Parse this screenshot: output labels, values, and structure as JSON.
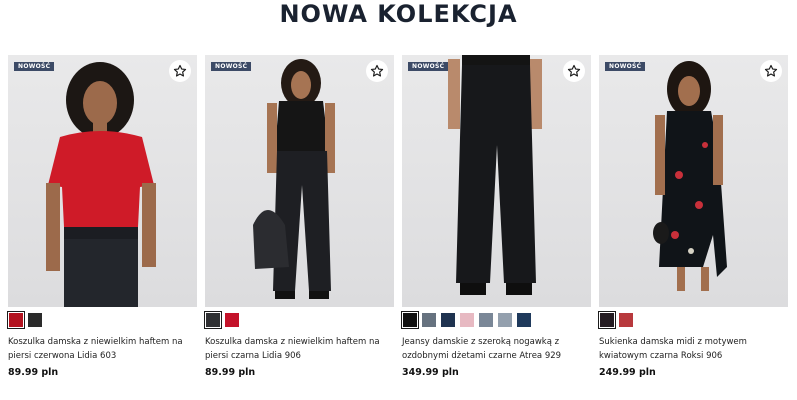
{
  "section": {
    "title": "NOWA KOLEKCJA"
  },
  "products": [
    {
      "badge": "NOWOŚĆ",
      "name": "Koszulka damska z niewielkim haftem na piersi czerwona Lidia 603",
      "price": "89.99 pln",
      "swatches": [
        "#b3121f",
        "#2b2b2b"
      ]
    },
    {
      "badge": "NOWOŚĆ",
      "name": "Koszulka damska z niewielkim haftem na piersi czarna Lidia 906",
      "price": "89.99 pln",
      "swatches": [
        "#2f3033",
        "#c4122a"
      ]
    },
    {
      "badge": "NOWOŚĆ",
      "name": "Jeansy damskie z szeroką nogawką z ozdobnymi dżetami czarne Atrea 929",
      "price": "349.99 pln",
      "swatches": [
        "#111111",
        "#66727f",
        "#1f3350",
        "#e7b9c2",
        "#7a8797",
        "#94a0ae",
        "#1f3a5c"
      ]
    },
    {
      "badge": "NOWOŚĆ",
      "name": "Sukienka damska midi z motywem kwiatowym czarna Roksi 906",
      "price": "249.99 pln",
      "swatches": [
        "#241c22",
        "#b8393d"
      ]
    }
  ]
}
